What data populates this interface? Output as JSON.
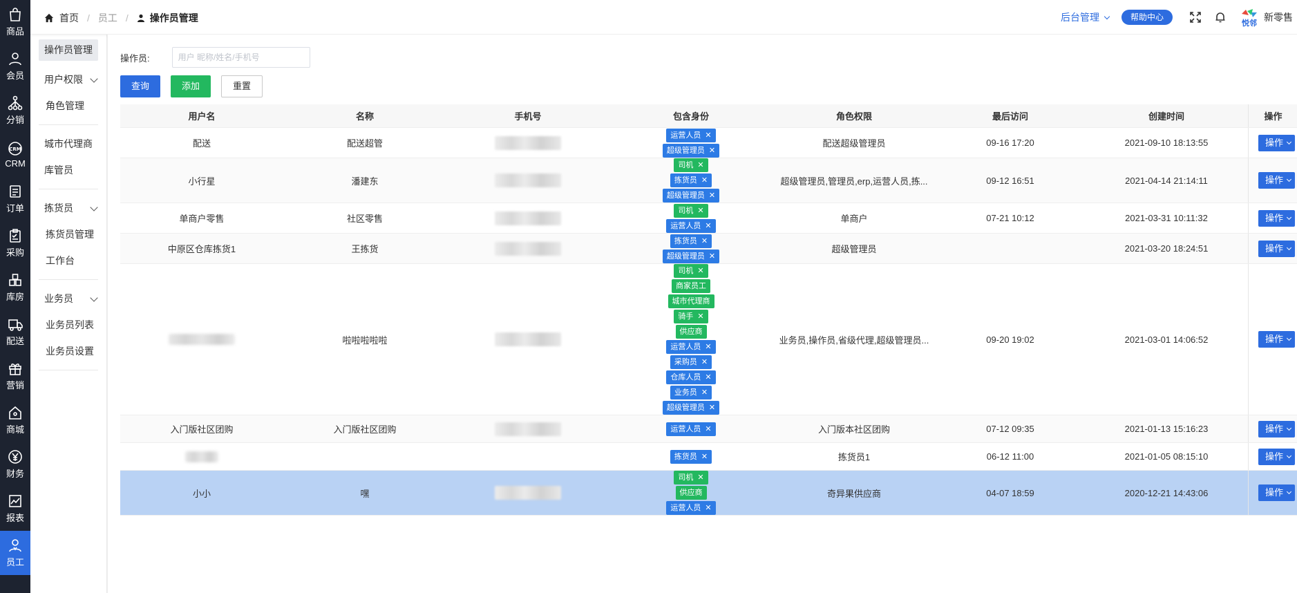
{
  "rail": [
    {
      "label": "商品",
      "icon": "shopping-bag-icon"
    },
    {
      "label": "会员",
      "icon": "user-icon"
    },
    {
      "label": "分销",
      "icon": "network-icon"
    },
    {
      "label": "CRM",
      "icon": "crm-icon"
    },
    {
      "label": "订单",
      "icon": "order-icon"
    },
    {
      "label": "采购",
      "icon": "clipboard-icon"
    },
    {
      "label": "库房",
      "icon": "warehouse-icon"
    },
    {
      "label": "配送",
      "icon": "delivery-icon"
    },
    {
      "label": "营销",
      "icon": "gift-icon"
    },
    {
      "label": "商城",
      "icon": "store-icon"
    },
    {
      "label": "财务",
      "icon": "yen-icon"
    },
    {
      "label": "报表",
      "icon": "chart-icon"
    },
    {
      "label": "员工",
      "icon": "staff-icon"
    }
  ],
  "subnav": {
    "active": "操作员管理",
    "user_rights": "用户权限",
    "role_mgmt": "角色管理",
    "city_agent": "城市代理商",
    "storekeeper": "库管员",
    "picker": "拣货员",
    "picker_mgmt": "拣货员管理",
    "workbench": "工作台",
    "salesman": "业务员",
    "salesman_list": "业务员列表",
    "salesman_settings": "业务员设置"
  },
  "header": {
    "crumb_home": "首页",
    "crumb_staff": "员工",
    "crumb_current": "操作员管理",
    "admin_menu": "后台管理",
    "help": "帮助中心",
    "brand": "新零售",
    "logo_text": "悦邻"
  },
  "filter": {
    "label": "操作员:",
    "placeholder": "用户 昵称/姓名/手机号",
    "query": "查询",
    "add": "添加",
    "reset": "重置"
  },
  "table": {
    "headers": [
      "用户名",
      "名称",
      "手机号",
      "包含身份",
      "角色权限",
      "最后访问",
      "创建时间",
      "操作"
    ],
    "op_label": "操作",
    "rows": [
      {
        "username": "配送",
        "name": "配送超管",
        "tags": [
          [
            "运营人员",
            "blue",
            true
          ],
          [
            "超级管理员",
            "blue",
            true
          ]
        ],
        "role": "配送超级管理员",
        "last": "09-16 17:20",
        "created": "2021-09-10 18:13:55"
      },
      {
        "username": "小行星",
        "name": "潘建东",
        "tags": [
          [
            "司机",
            "green",
            true
          ],
          [
            "拣货员",
            "blue",
            true
          ],
          [
            "超级管理员",
            "blue",
            true
          ]
        ],
        "role": "超级管理员,管理员,erp,运营人员,拣...",
        "last": "09-12 16:51",
        "created": "2021-04-14 21:14:11"
      },
      {
        "username": "单商户零售",
        "name": "社区零售",
        "tags": [
          [
            "司机",
            "green",
            true
          ],
          [
            "运营人员",
            "blue",
            true
          ]
        ],
        "role": "单商户",
        "last": "07-21 10:12",
        "created": "2021-03-31 10:11:32"
      },
      {
        "username": "中原区仓库拣货1",
        "name": "王拣货",
        "tags": [
          [
            "拣货员",
            "blue",
            true
          ],
          [
            "超级管理员",
            "blue",
            true
          ]
        ],
        "role": "超级管理员",
        "last": "",
        "created": "2021-03-20 18:24:51"
      },
      {
        "username": "",
        "name": "啦啦啦啦啦",
        "tags": [
          [
            "司机",
            "green",
            true
          ],
          [
            "商家员工",
            "green",
            false
          ],
          [
            "城市代理商",
            "green",
            false
          ],
          [
            "骑手",
            "green",
            true
          ],
          [
            "供应商",
            "green",
            false
          ],
          [
            "运营人员",
            "blue",
            true
          ],
          [
            "采购员",
            "blue",
            true
          ],
          [
            "仓库人员",
            "blue",
            true
          ],
          [
            "业务员",
            "blue",
            true
          ],
          [
            "超级管理员",
            "blue",
            true
          ]
        ],
        "role": "业务员,操作员,省级代理,超级管理员...",
        "last": "09-20 19:02",
        "created": "2021-03-01 14:06:52"
      },
      {
        "username": "入门版社区团购",
        "name": "入门版社区团购",
        "tags": [
          [
            "运营人员",
            "blue",
            true
          ]
        ],
        "role": "入门版本社区团购",
        "last": "07-12 09:35",
        "created": "2021-01-13 15:16:23"
      },
      {
        "username": "",
        "name": "",
        "tags": [
          [
            "拣货员",
            "blue",
            true
          ]
        ],
        "role": "拣货员1",
        "last": "06-12 11:00",
        "created": "2021-01-05 08:15:10"
      },
      {
        "username": "小小",
        "name": "嘿",
        "tags": [
          [
            "司机",
            "green",
            true
          ],
          [
            "供应商",
            "green",
            false
          ],
          [
            "运营人员",
            "blue",
            true
          ]
        ],
        "role": "奇异果供应商",
        "last": "04-07 18:59",
        "created": "2020-12-21 14:43:06"
      }
    ]
  },
  "colors": {
    "rail_bg": "#1d2330",
    "primary": "#2d6cdf",
    "success": "#23b85f",
    "tag_blue": "#2d7be5",
    "selected_row": "#b9d2f4"
  }
}
